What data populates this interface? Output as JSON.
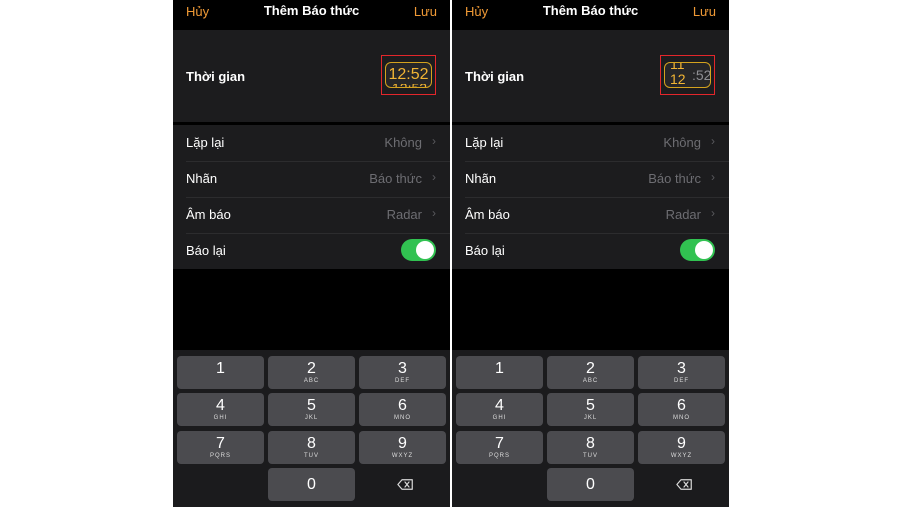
{
  "header": {
    "cancel": "Hủy",
    "title": "Thêm Báo thức",
    "save": "Lưu"
  },
  "time": {
    "label": "Thời gian",
    "left_display": "12:52",
    "right_scroll_top": "11",
    "right_scroll_bottom": "12",
    "right_suffix": ":52"
  },
  "settings": [
    {
      "label": "Lặp lại",
      "value": "Không"
    },
    {
      "label": "Nhãn",
      "value": "Báo thức"
    },
    {
      "label": "Âm báo",
      "value": "Radar"
    }
  ],
  "snooze": {
    "label": "Báo lại",
    "on": true
  },
  "keypad": {
    "keys": [
      {
        "num": "1",
        "letters": ""
      },
      {
        "num": "2",
        "letters": "ABC"
      },
      {
        "num": "3",
        "letters": "DEF"
      },
      {
        "num": "4",
        "letters": "GHI"
      },
      {
        "num": "5",
        "letters": "JKL"
      },
      {
        "num": "6",
        "letters": "MNO"
      },
      {
        "num": "7",
        "letters": "PQRS"
      },
      {
        "num": "8",
        "letters": "TUV"
      },
      {
        "num": "9",
        "letters": "WXYZ"
      }
    ],
    "zero": "0"
  },
  "colors": {
    "accent": "#f09a36",
    "toggle": "#31c251",
    "highlight": "#e3262b"
  }
}
